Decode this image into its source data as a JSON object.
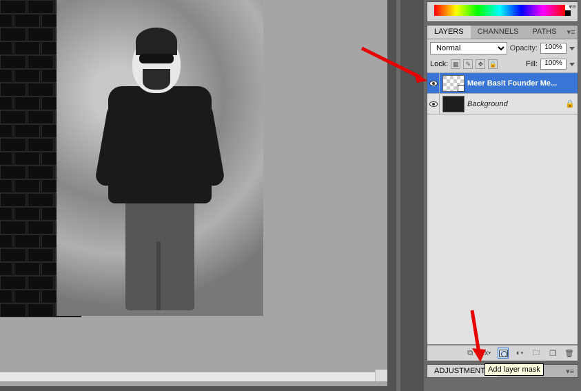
{
  "panels": {
    "layers": {
      "tabs": [
        "LAYERS",
        "CHANNELS",
        "PATHS"
      ],
      "blend_mode": "Normal",
      "opacity_label": "Opacity:",
      "opacity_value": "100%",
      "lock_label": "Lock:",
      "fill_label": "Fill:",
      "fill_value": "100%",
      "items": [
        {
          "name": "Meer Basit Founder Me...",
          "visible": true,
          "selected": true,
          "smart": true,
          "thumb": "checker"
        },
        {
          "name": "Background",
          "visible": true,
          "selected": false,
          "italic": true,
          "locked": true,
          "thumb": "dark"
        }
      ]
    },
    "adjustments": {
      "tabs": [
        "ADJUSTMENTS"
      ]
    }
  },
  "tooltip": "Add layer mask",
  "bottom_icons": {
    "link": "⧉",
    "fx": "fx",
    "mask": "",
    "adj": "◐",
    "group": "▭",
    "new": "▤",
    "trash": "🗑"
  }
}
